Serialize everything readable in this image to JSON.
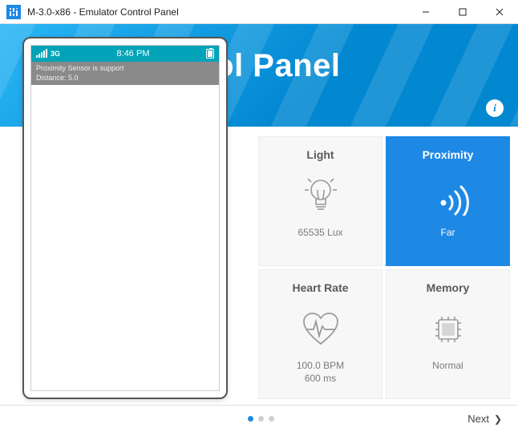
{
  "window": {
    "title": "M-3.0-x86 - Emulator Control Panel"
  },
  "hero": {
    "title": "Control Panel"
  },
  "device": {
    "statusbar": {
      "network": "3G",
      "time": "8:46 PM"
    },
    "lines": {
      "l1": "Proximity Sensor is support",
      "l2": "Distance: 5.0"
    }
  },
  "sensors": {
    "light": {
      "title": "Light",
      "value": "65535 Lux"
    },
    "proximity": {
      "title": "Proximity",
      "value": "Far"
    },
    "heartrate": {
      "title": "Heart Rate",
      "value1": "100.0 BPM",
      "value2": "600 ms"
    },
    "memory": {
      "title": "Memory",
      "value": "Normal"
    }
  },
  "footer": {
    "next": "Next"
  }
}
